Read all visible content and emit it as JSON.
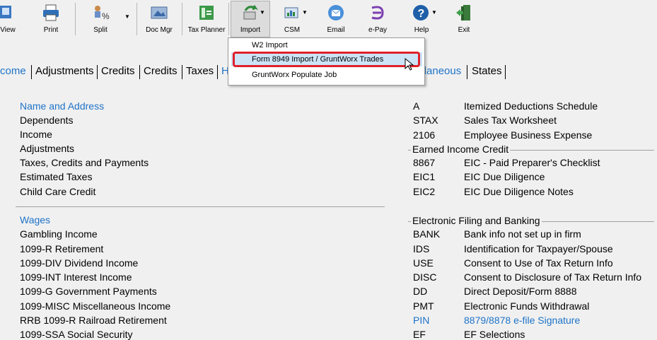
{
  "toolbar": {
    "buttons": [
      {
        "label": "View",
        "icon": "view-icon"
      },
      {
        "label": "Print",
        "icon": "printer-icon"
      },
      {
        "label": "Split",
        "icon": "split-icon"
      },
      {
        "label": "Doc Mgr",
        "icon": "doc-mgr-icon"
      },
      {
        "label": "Tax Planner",
        "icon": "tax-planner-icon"
      },
      {
        "label": "Import",
        "icon": "import-icon"
      },
      {
        "label": "CSM",
        "icon": "csm-icon"
      },
      {
        "label": "Email",
        "icon": "email-icon"
      },
      {
        "label": "e-Pay",
        "icon": "epay-icon"
      },
      {
        "label": "Help",
        "icon": "help-icon"
      },
      {
        "label": "Exit",
        "icon": "exit-icon"
      }
    ]
  },
  "import_menu": {
    "items": [
      "W2 Import",
      "Form 8949 Import / GruntWorx Trades",
      "GruntWorx Populate Job"
    ]
  },
  "tabs": [
    "come",
    "Adjustments",
    "Credits",
    "Credits",
    "Taxes",
    "H",
    "ellaneous",
    "States"
  ],
  "left_sections": {
    "section1": [
      "Name and Address",
      "Dependents",
      "Income",
      "Adjustments",
      "Taxes, Credits and Payments",
      "Estimated Taxes",
      "Child Care Credit"
    ],
    "section2": [
      "Wages",
      "Gambling Income",
      "1099-R  Retirement",
      "1099-DIV  Dividend Income",
      "1099-INT  Interest Income",
      "1099-G  Government Payments",
      "1099-MISC  Miscellaneous Income",
      "RRB 1099-R  Railroad Retirement",
      "1099-SSA  Social Security"
    ]
  },
  "right_sections": {
    "top": [
      {
        "code": "A",
        "desc": "Itemized Deductions Schedule"
      },
      {
        "code": "STAX",
        "desc": "Sales Tax Worksheet"
      },
      {
        "code": "2106",
        "desc": "Employee Business Expense"
      }
    ],
    "eic_title": "Earned Income Credit",
    "eic": [
      {
        "code": "8867",
        "desc": "EIC - Paid Preparer's Checklist"
      },
      {
        "code": "EIC1",
        "desc": "EIC Due Diligence"
      },
      {
        "code": "EIC2",
        "desc": "EIC Due Diligence Notes"
      }
    ],
    "efile_title": "Electronic Filing and Banking",
    "efile": [
      {
        "code": "BANK",
        "desc": "Bank info not set up in firm"
      },
      {
        "code": "IDS",
        "desc": "Identification for Taxpayer/Spouse"
      },
      {
        "code": "USE",
        "desc": "Consent to Use of Tax Return Info"
      },
      {
        "code": "DISC",
        "desc": "Consent to Disclosure of Tax Return Info"
      },
      {
        "code": "DD",
        "desc": "Direct Deposit/Form 8888"
      },
      {
        "code": "PMT",
        "desc": "Electronic Funds Withdrawal"
      },
      {
        "code": "PIN",
        "desc": "8879/8878 e-file Signature"
      },
      {
        "code": "EF",
        "desc": "EF Selections"
      }
    ]
  },
  "colors": {
    "link": "#1e73c8",
    "highlight_border": "#e0202b",
    "menu_hover": "#cde4f7"
  }
}
